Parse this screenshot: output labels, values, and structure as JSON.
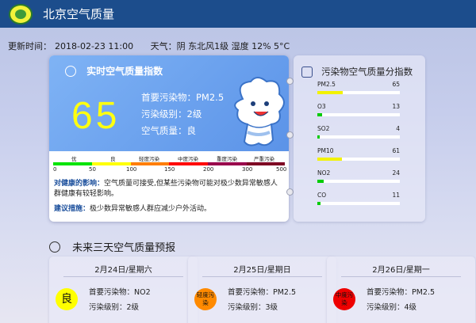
{
  "header": {
    "title": "北京空气质量"
  },
  "update": {
    "label": "更新时间：",
    "time": "2018-02-23 11:00",
    "weather": "天气：阴 东北风1级 湿度 12% 5°C"
  },
  "realtime": {
    "title": "实时空气质量指数",
    "aqi": "65",
    "primary": "首要污染物：PM2.5",
    "level": "污染级别：2级",
    "quality": "空气质量：良",
    "scale_labels": [
      "优",
      "良",
      "轻度污染",
      "中度污染",
      "重度污染",
      "严重污染"
    ],
    "scale_ticks": [
      "0",
      "50",
      "100",
      "150",
      "200",
      "300",
      "500"
    ],
    "scale_colors": [
      "#00e400",
      "#ffff00",
      "#ff7e00",
      "#ff0000",
      "#99004c",
      "#7e0023"
    ],
    "health_label": "对健康的影响：",
    "health_text": "空气质量可接受,但某些污染物可能对极少数异常敏感人群健康有较轻影响。",
    "advice_label": "建议措施：",
    "advice_text": "极少数异常敏感人群应减少户外活动。"
  },
  "pollutants": {
    "title": "污染物空气质量分指数",
    "items": [
      {
        "name": "PM2.5",
        "value": "65",
        "color": "#f2f200",
        "fraction": 0.31
      },
      {
        "name": "O3",
        "value": "13",
        "color": "#00cc00",
        "fraction": 0.06
      },
      {
        "name": "SO2",
        "value": "4",
        "color": "#00cc00",
        "fraction": 0.03
      },
      {
        "name": "PM10",
        "value": "61",
        "color": "#f2f200",
        "fraction": 0.3
      },
      {
        "name": "NO2",
        "value": "24",
        "color": "#00cc00",
        "fraction": 0.08
      },
      {
        "name": "CO",
        "value": "11",
        "color": "#00cc00",
        "fraction": 0.04
      }
    ]
  },
  "forecast": {
    "title": "未来三天空气质量预报",
    "days": [
      {
        "date": "2月24日/星期六",
        "badge": "良",
        "badge_color": "#ffff00",
        "primary": "首要污染物：NO2",
        "level": "污染级别：2级"
      },
      {
        "date": "2月25日/星期日",
        "badge": "轻度污染",
        "badge_color": "#ff8a00",
        "primary": "首要污染物：PM2.5",
        "level": "污染级别：3级"
      },
      {
        "date": "2月26日/星期一",
        "badge": "中度污染",
        "badge_color": "#ee0000",
        "primary": "首要污染物：PM2.5",
        "level": "污染级别：4级"
      }
    ]
  }
}
